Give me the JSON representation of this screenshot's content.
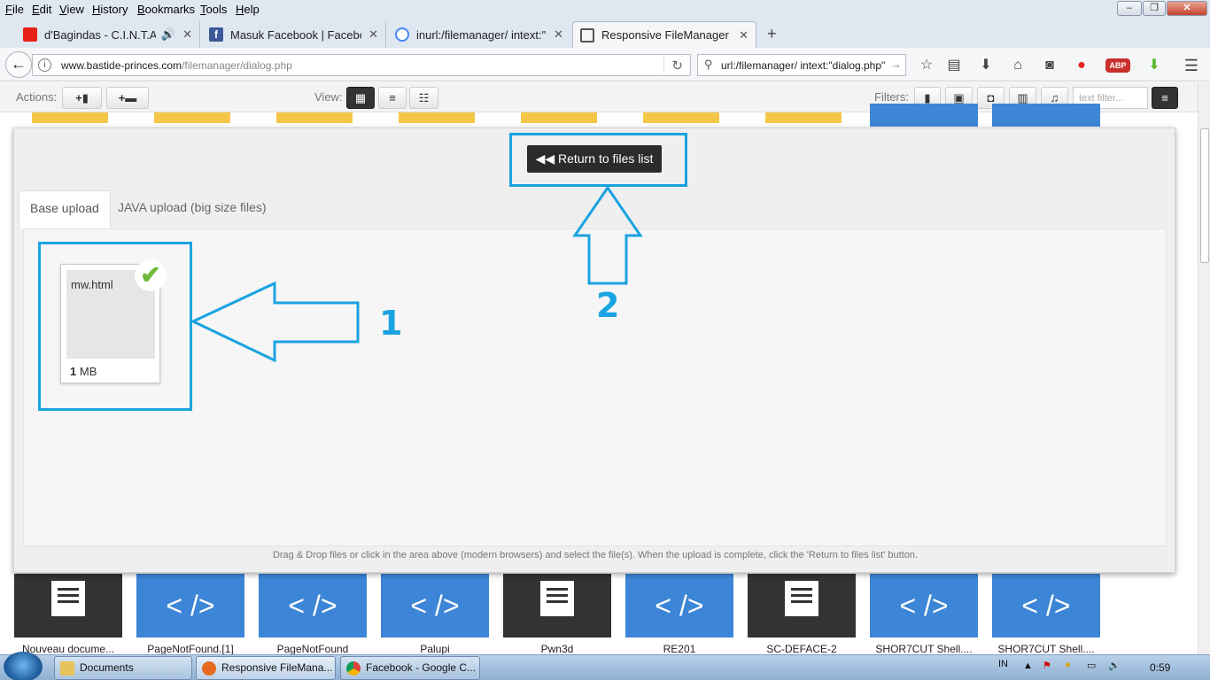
{
  "window": {
    "menu": [
      "File",
      "Edit",
      "View",
      "History",
      "Bookmarks",
      "Tools",
      "Help"
    ],
    "controls": {
      "minimize": "–",
      "maximize": "❐",
      "close": "✕"
    }
  },
  "tabs": [
    {
      "title": "d'Bagindas - C.I.N.T.A |...",
      "icon": "youtube-icon",
      "color": "#e62117"
    },
    {
      "title": "Masuk Facebook | Facebook",
      "icon": "facebook-icon",
      "color": "#3b5998"
    },
    {
      "title": "inurl:/filemanager/ intext:\"...",
      "icon": "google-icon",
      "color": "#4285f4"
    },
    {
      "title": "Responsive FileManager",
      "icon": "filemanager-icon",
      "color": "#555555",
      "active": true
    }
  ],
  "address": {
    "domain": "www.bastide-princes.com",
    "path": "/filemanager/dialog.php"
  },
  "search": {
    "query": "url:/filemanager/ intext:\"dialog.php\""
  },
  "toolbar": {
    "actions_label": "Actions:",
    "view_label": "View:",
    "filters_label": "Filters:",
    "filter_placeholder": "text filter..."
  },
  "dialog": {
    "return_button": "Return to files list",
    "tabs": [
      "Base upload",
      "JAVA upload (big size files)"
    ],
    "uploaded_file": {
      "name": "mw.html",
      "size_value": "1",
      "size_unit": "MB"
    },
    "hint": "Drag & Drop files or click in the area above (modern browsers) and select the file(s). When the upload is complete, click the 'Return to files list' button."
  },
  "annotations": {
    "label_1": "1",
    "label_2": "2",
    "color": "#1aa3e0"
  },
  "files": [
    {
      "name": "Nouveau docume...",
      "type": "doc"
    },
    {
      "name": "PageNotFound.[1]",
      "type": "code"
    },
    {
      "name": "PageNotFound",
      "type": "code"
    },
    {
      "name": "Palupi",
      "type": "code"
    },
    {
      "name": "Pwn3d",
      "type": "doc"
    },
    {
      "name": "RE201",
      "type": "code"
    },
    {
      "name": "SC-DEFACE-2",
      "type": "doc"
    },
    {
      "name": "SHOR7CUT Shell....",
      "type": "code"
    },
    {
      "name": "SHOR7CUT Shell....",
      "type": "code"
    }
  ],
  "code_glyph": "< />",
  "taskbar": {
    "items": [
      "Documents",
      "Responsive FileMana...",
      "Facebook - Google C..."
    ],
    "lang": "IN",
    "time": "0:59"
  }
}
